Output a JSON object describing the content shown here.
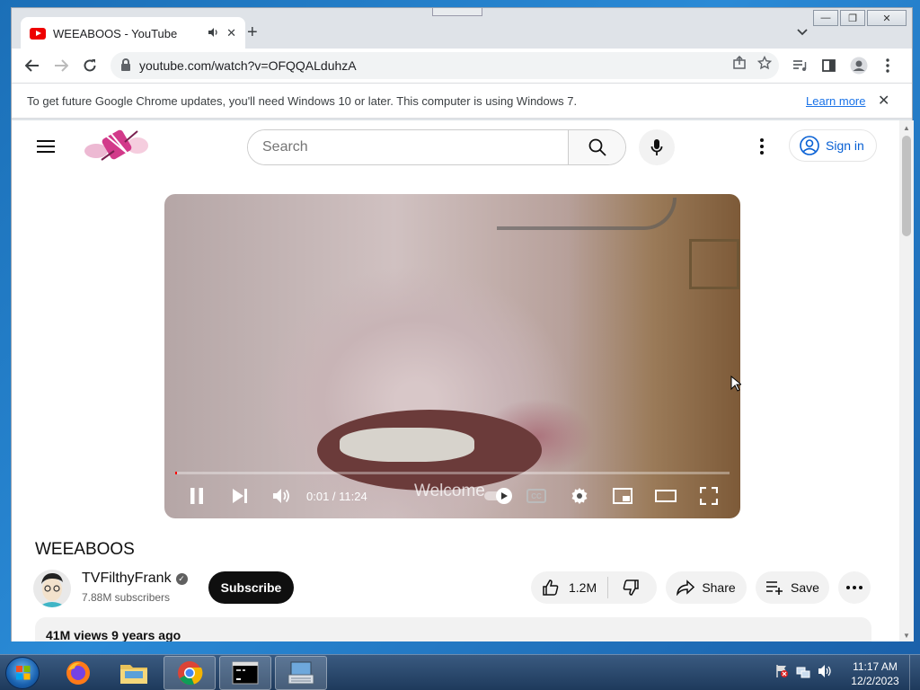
{
  "browser": {
    "tab_title": "WEEABOOS - YouTube",
    "url": "youtube.com/watch?v=OFQQALduhzA",
    "new_tab_symbol": "+",
    "window_buttons": {
      "minimize": "—",
      "restore": "❐",
      "close": "✕"
    }
  },
  "infobar": {
    "message": "To get future Google Chrome updates, you'll need Windows 10 or later. This computer is using Windows 7.",
    "learn_more": "Learn more",
    "close": "✕"
  },
  "youtube": {
    "search_placeholder": "Search",
    "sign_in": "Sign in"
  },
  "player": {
    "current_time": "0:01",
    "duration": "11:24",
    "time_display": "0:01 / 11:24",
    "overlay_text": "Welcome",
    "progress": 0.002
  },
  "video": {
    "title": "WEEABOOS",
    "channel": "TVFilthyFrank",
    "subscribers": "7.88M subscribers",
    "subscribe_label": "Subscribe",
    "likes": "1.2M",
    "share_label": "Share",
    "save_label": "Save",
    "views_meta": "41M views  9 years ago"
  },
  "taskbar": {
    "time": "11:17 AM",
    "date": "12/2/2023"
  },
  "colors": {
    "yt_red": "#ff0000",
    "link_blue": "#065fd4",
    "chrome_blue": "#1a73e8"
  }
}
